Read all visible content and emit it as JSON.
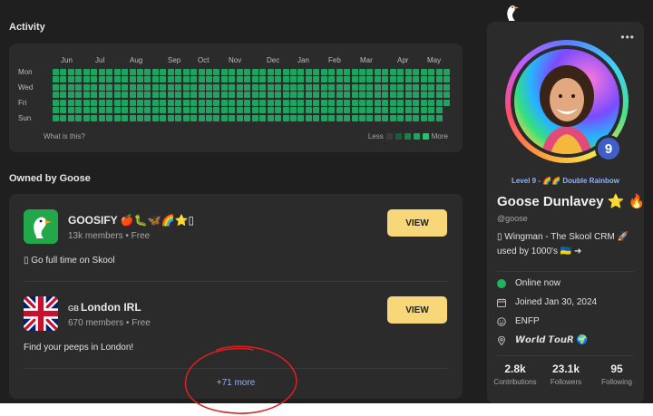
{
  "activity": {
    "title": "Activity",
    "months": [
      "Jun",
      "Jul",
      "Aug",
      "Sep",
      "Oct",
      "Nov",
      "Dec",
      "Jan",
      "Feb",
      "Mar",
      "Apr",
      "May"
    ],
    "days": [
      "Mon",
      "Wed",
      "Fri",
      "Sun"
    ],
    "what_link": "What is this?",
    "legend_less": "Less",
    "legend_more": "More",
    "cell_color": "#1fa360",
    "legend_colors": [
      "#3b3b3b",
      "#1c5c3a",
      "#1a8048",
      "#1fa360",
      "#27c070"
    ]
  },
  "owned": {
    "title": "Owned by Goose",
    "groups": [
      {
        "name": "GOOSIFY 🍎🐛🦋🌈⭐▯",
        "meta": "13k members • Free",
        "description": "▯ Go full time on Skool",
        "button": "VIEW",
        "icon": "goose-logo"
      },
      {
        "name": "GB London IRL",
        "name_prefix": "GB",
        "name_main": "London IRL",
        "meta": "670 members • Free",
        "description": "Find your peeps in London!",
        "button": "VIEW",
        "icon": "uk-flag"
      }
    ],
    "more": "+71 more"
  },
  "profile": {
    "menu": "•••",
    "level_number": "9",
    "level_text": "Level 9 - 🌈🌈 Double Rainbow",
    "name": "Goose Dunlavey ⭐ 🔥",
    "handle": "@goose",
    "bio": "▯ Wingman - The Skool CRM 🚀 used by 1000's 🇺🇦 ➜",
    "online": "Online now",
    "joined": "Joined Jan 30, 2024",
    "personality": "ENFP",
    "location": "𝙒𝙤𝙧𝙡𝙙 𝙏𝙤𝙪𝙍 🌍",
    "online_color": "#22b35e",
    "stats": [
      {
        "value": "2.8k",
        "label": "Contributions"
      },
      {
        "value": "23.1k",
        "label": "Followers"
      },
      {
        "value": "95",
        "label": "Following"
      }
    ]
  }
}
